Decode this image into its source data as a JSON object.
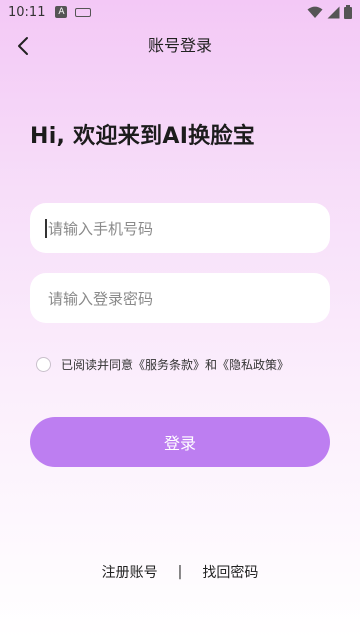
{
  "status_bar": {
    "time": "10:11",
    "notification_badge": "A",
    "icons": [
      "keyboard-icon",
      "wifi-icon",
      "cellular-signal-icon",
      "battery-icon"
    ]
  },
  "nav": {
    "back_icon": "chevron-left-icon",
    "title": "账号登录"
  },
  "welcome": "Hi, 欢迎来到AI换脸宝",
  "form": {
    "phone_placeholder": "请输入手机号码",
    "password_placeholder": "请输入登录密码",
    "agreement": {
      "prefix": "已阅读并同意",
      "terms_link": "《服务条款》",
      "and_text": "和",
      "privacy_link": "《隐私政策》",
      "checked": false
    },
    "login_label": "登录"
  },
  "footer": {
    "register_label": "注册账号",
    "divider": "|",
    "recover_label": "找回密码"
  },
  "colors": {
    "accent": "#bd7ef1",
    "gradient_top": "#f3c8f6",
    "background_bottom": "#ffffff"
  }
}
